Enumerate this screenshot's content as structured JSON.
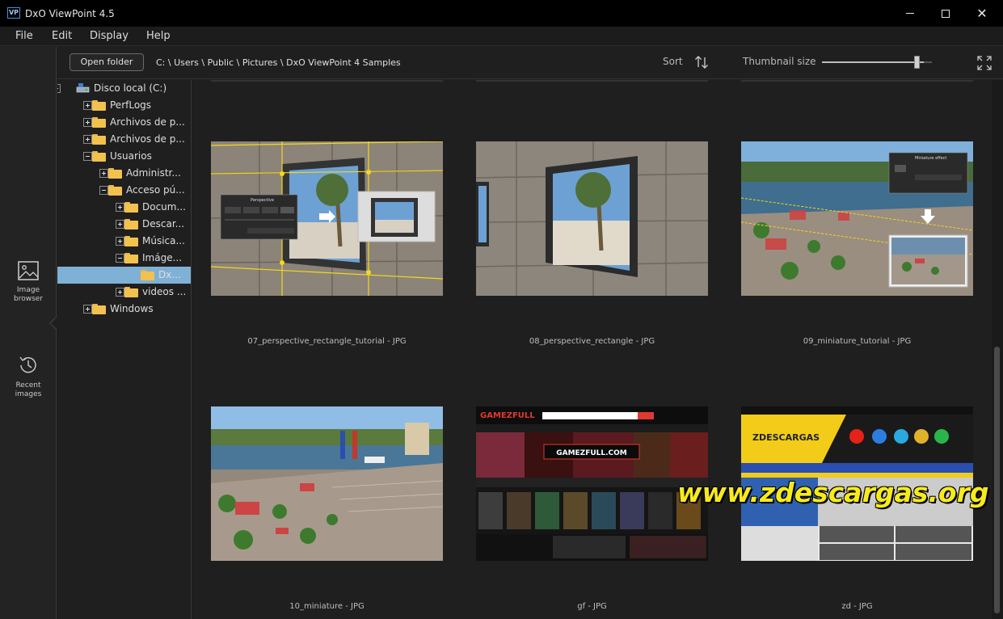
{
  "window": {
    "title": "DxO ViewPoint 4.5",
    "logo_text": "VP"
  },
  "menu": [
    "File",
    "Edit",
    "Display",
    "Help"
  ],
  "rail": {
    "image_browser_label": "Image browser",
    "recent_images_label": "Recent images"
  },
  "toolbar": {
    "open_folder_label": "Open folder",
    "path": "C: \\ Users \\ Public \\ Pictures \\ DxO ViewPoint 4 Samples",
    "sort_label": "Sort",
    "thumbnail_size_label": "Thumbnail size",
    "thumbnail_size_level": 0.88
  },
  "tree": [
    {
      "label": "Disco local (C:)",
      "type": "drive",
      "expander": "minus"
    },
    {
      "label": "PerfLogs",
      "type": "folder",
      "expander": "plus"
    },
    {
      "label": "Archivos de p...",
      "type": "folder",
      "expander": "plus"
    },
    {
      "label": "Archivos de p...",
      "type": "folder",
      "expander": "plus"
    },
    {
      "label": "Usuarios",
      "type": "folder",
      "expander": "minus"
    },
    {
      "label": "Administr...",
      "type": "folder",
      "expander": "plus"
    },
    {
      "label": "Acceso pú...",
      "type": "folder",
      "expander": "minus"
    },
    {
      "label": "Docum...",
      "type": "folder",
      "expander": "plus"
    },
    {
      "label": "Descar...",
      "type": "folder",
      "expander": "plus"
    },
    {
      "label": "Música...",
      "type": "folder",
      "expander": "plus"
    },
    {
      "label": "Imáge...",
      "type": "folder",
      "expander": "minus"
    },
    {
      "label": "Dx...",
      "type": "folder",
      "expander": "none",
      "selected": true
    },
    {
      "label": "videos ...",
      "type": "folder",
      "expander": "plus"
    },
    {
      "label": "Windows",
      "type": "folder",
      "expander": "plus"
    }
  ],
  "thumbnails": [
    {
      "caption": "07_perspective_rectangle_tutorial - JPG"
    },
    {
      "caption": "08_perspective_rectangle - JPG"
    },
    {
      "caption": "09_miniature_tutorial - JPG"
    },
    {
      "caption": "10_miniature - JPG"
    },
    {
      "caption": "gf - JPG"
    },
    {
      "caption": "zd - JPG"
    }
  ],
  "thumbnail_text": {
    "perspective_panel_title": "Perspective",
    "miniature_panel_title": "Miniature effect",
    "gamezfull_brand": "GAMEZFULL",
    "gamezfull_url": "GAMEZFULL.COM",
    "zdescargas_brand": "ZDESCARGAS"
  },
  "watermark": "www.zdescargas.org",
  "colors": {
    "selection": "#7fb1d6",
    "folder": "#f2c14e",
    "accent": "#f6ea1e"
  }
}
